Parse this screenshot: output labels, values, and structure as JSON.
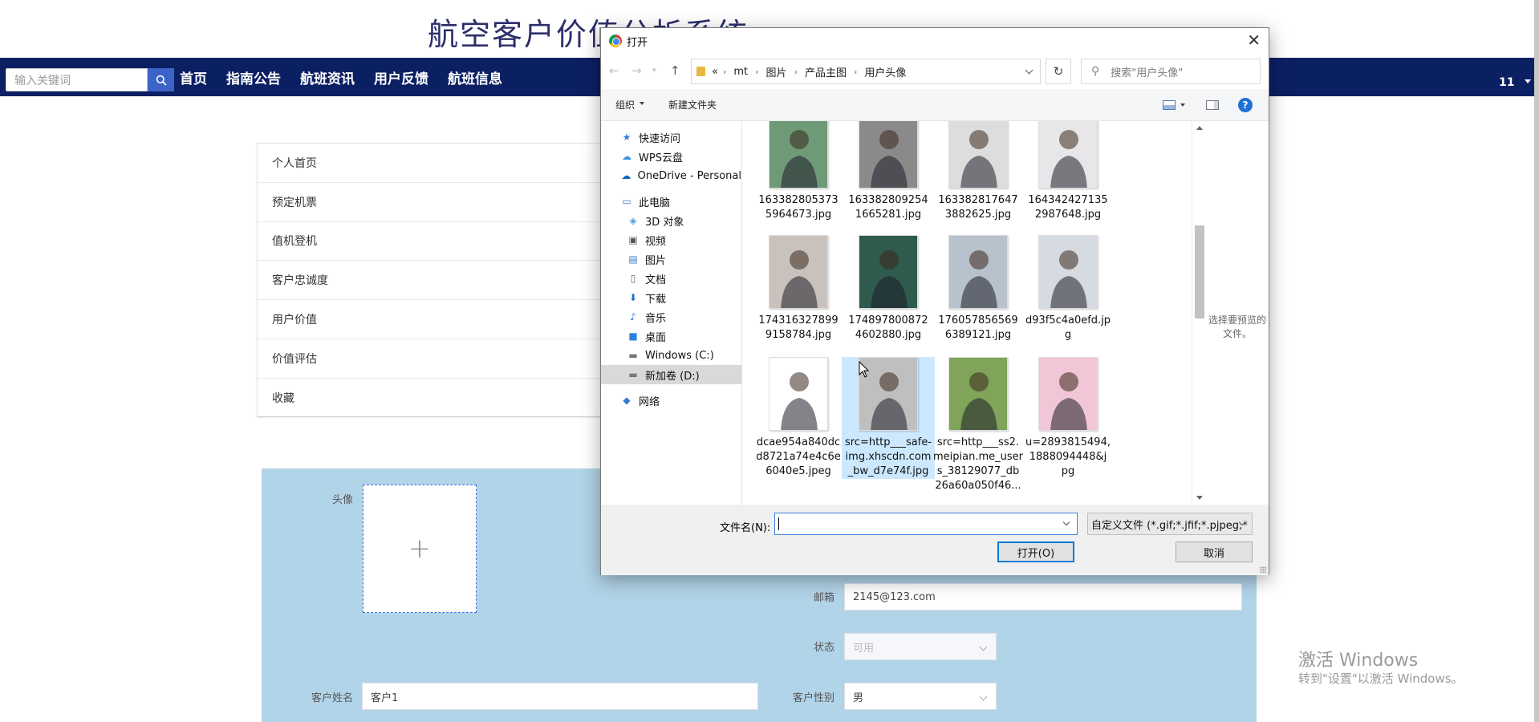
{
  "page": {
    "title": "航空客户价值分析系统",
    "search_placeholder": "输入关键词",
    "nav": [
      "首页",
      "指南公告",
      "航班资讯",
      "用户反馈",
      "航班信息"
    ],
    "user": "11",
    "side_menu": [
      "个人首页",
      "预定机票",
      "值机登机",
      "客户忠诚度",
      "用户价值",
      "价值评估",
      "收藏"
    ],
    "form": {
      "avatar_label": "头像",
      "upload_plus": "+",
      "email_label": "邮箱",
      "email_value": "2145@123.com",
      "status_label": "状态",
      "status_value": "可用",
      "name_label": "客户姓名",
      "name_value": "客户1",
      "gender_label": "客户性别",
      "gender_value": "男"
    },
    "watermark_title": "激活 Windows",
    "watermark_sub": "转到\"设置\"以激活 Windows。"
  },
  "dialog": {
    "title": "打开",
    "close": "✕",
    "breadcrumb": [
      "«",
      "mt",
      "图片",
      "产品主图",
      "用户头像"
    ],
    "search_placeholder": "搜索\"用户头像\"",
    "organize": "组织",
    "new_folder": "新建文件夹",
    "help": "?",
    "tree": [
      {
        "label": "快速访问",
        "icon": "star-icon",
        "kind": "top"
      },
      {
        "label": "WPS云盘",
        "icon": "cloud-icon",
        "kind": "top"
      },
      {
        "label": "OneDrive - Personal",
        "icon": "onedrive-icon",
        "kind": "top"
      },
      {
        "label": "此电脑",
        "icon": "computer-icon",
        "kind": "top"
      },
      {
        "label": "3D 对象",
        "icon": "cube-icon",
        "kind": "sub"
      },
      {
        "label": "视频",
        "icon": "video-icon",
        "kind": "sub"
      },
      {
        "label": "图片",
        "icon": "picture-icon",
        "kind": "sub"
      },
      {
        "label": "文档",
        "icon": "document-icon",
        "kind": "sub"
      },
      {
        "label": "下载",
        "icon": "download-icon",
        "kind": "sub"
      },
      {
        "label": "音乐",
        "icon": "music-icon",
        "kind": "sub"
      },
      {
        "label": "桌面",
        "icon": "desktop-icon",
        "kind": "sub"
      },
      {
        "label": "Windows (C:)",
        "icon": "drive-icon",
        "kind": "sub"
      },
      {
        "label": "新加卷 (D:)",
        "icon": "drive-icon",
        "kind": "sub",
        "selected": true
      },
      {
        "label": "网络",
        "icon": "network-icon",
        "kind": "top"
      }
    ],
    "files": [
      {
        "name": "163382805373\n5964673.jpg",
        "bg": "#6e9a78"
      },
      {
        "name": "163382809254\n1665281.jpg",
        "bg": "#8a8a8a"
      },
      {
        "name": "163382817647\n3882625.jpg",
        "bg": "#dddddd"
      },
      {
        "name": "164342427135\n2987648.jpg",
        "bg": "#e8e6e8"
      },
      {
        "name": "174316327899\n9158784.jpg",
        "bg": "#c9c2bc"
      },
      {
        "name": "174897800872\n4602880.jpg",
        "bg": "#2f5a4e"
      },
      {
        "name": "176057856569\n6389121.jpg",
        "bg": "#b8c2cc"
      },
      {
        "name": "d93f5c4a0efd.jp\ng",
        "bg": "#d5dbe0"
      },
      {
        "name": "dcae954a840dc\nd8721a74e4c6e\n6040e5.jpeg",
        "bg": "#ffffff"
      },
      {
        "name": "src=http___safe-\nimg.xhscdn.com\n_bw_d7e74f.jpg",
        "bg": "#bfbfbf",
        "selected": true
      },
      {
        "name": "src=http___ss2.\nmeipian.me_user\ns_38129077_db\n26a60a050f46...",
        "bg": "#7fa45a"
      },
      {
        "name": "u=2893815494,\n1888094448&j\npg",
        "bg": "#f1c6d6"
      }
    ],
    "preview_hint": "选择要预览的文件。",
    "filename_label": "文件名(N):",
    "filename_value": "",
    "filetype": "自定义文件 (*.gif;*.jfif;*.pjpeg;*",
    "open_button": "打开(O)",
    "cancel_button": "取消"
  }
}
